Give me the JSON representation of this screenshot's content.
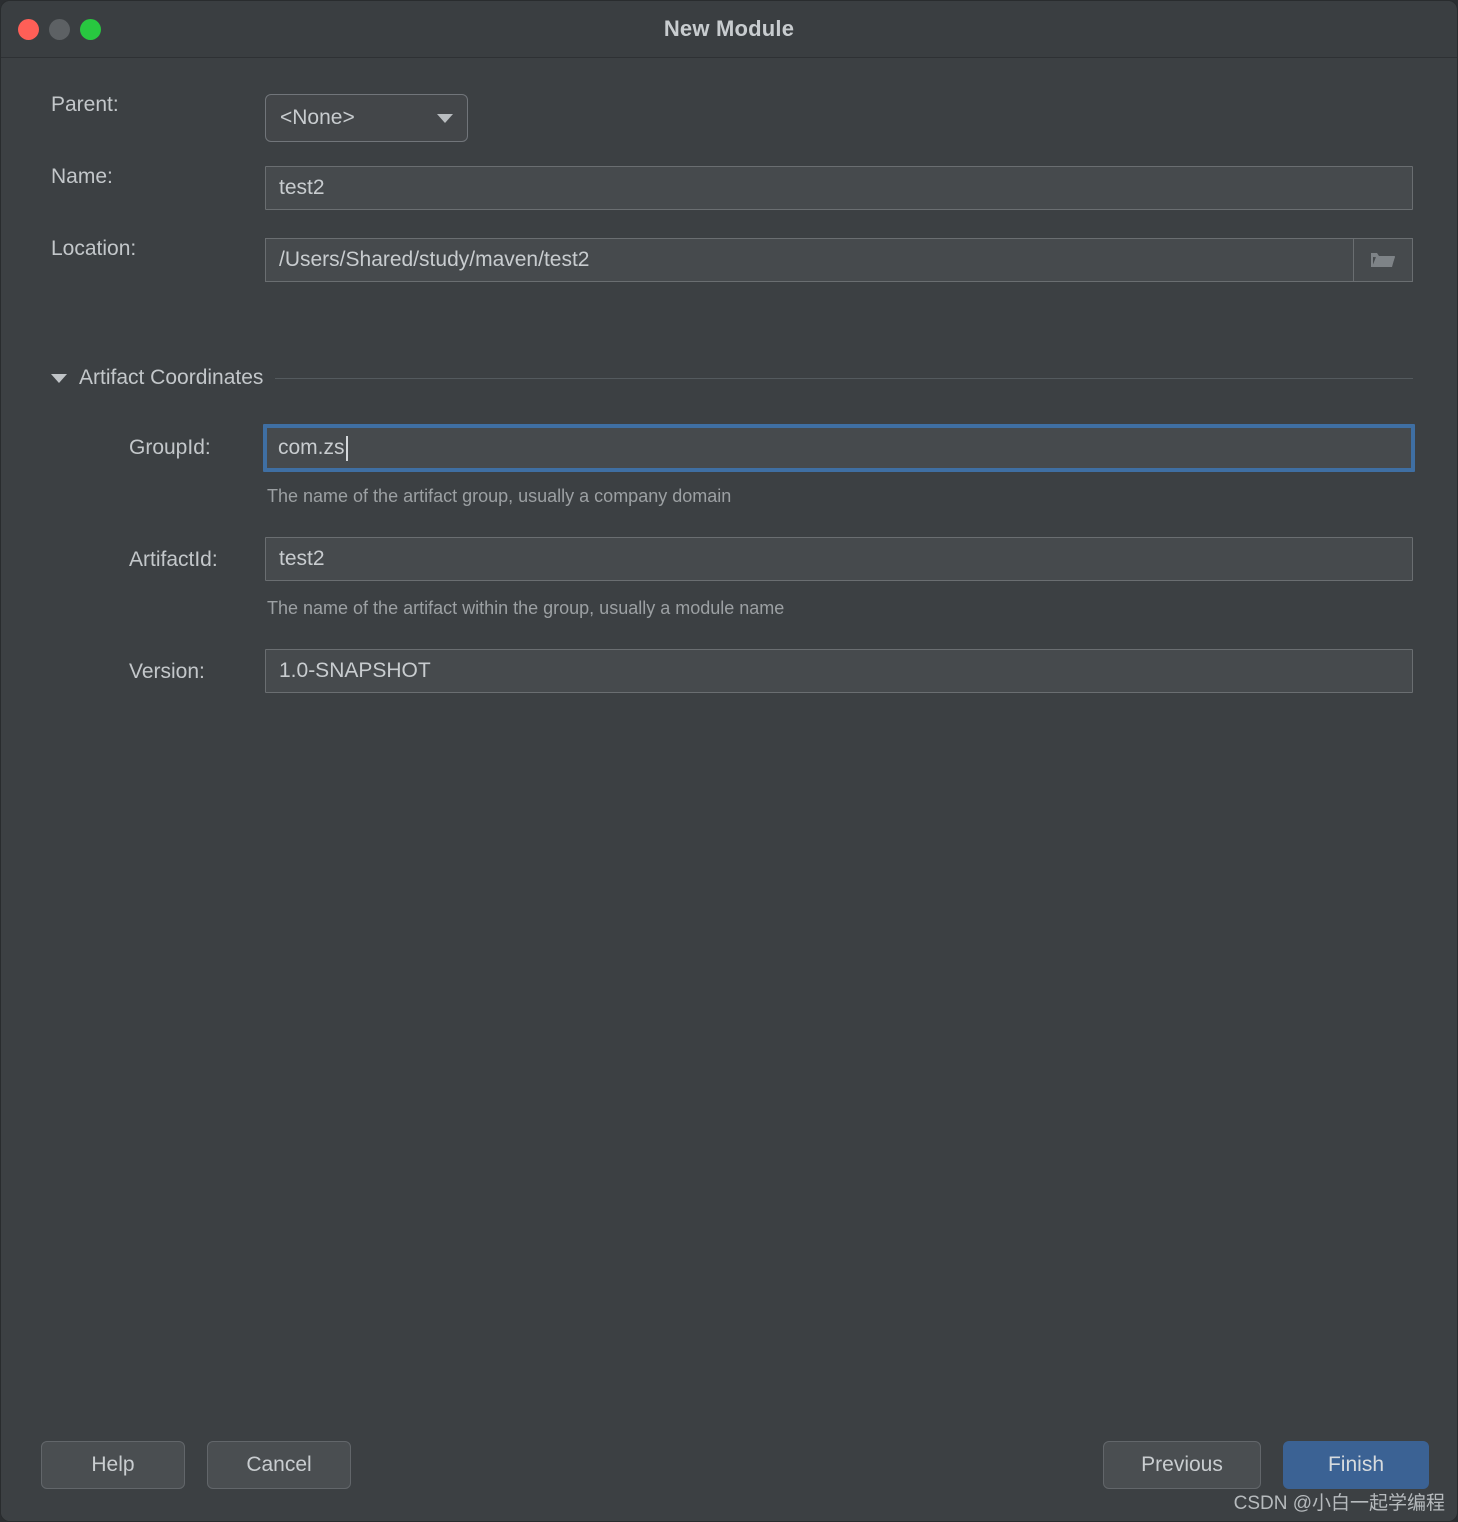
{
  "window": {
    "title": "New Module",
    "controls": {
      "close": "close-button",
      "minimize": "minimize-button",
      "maximize": "maximize-button"
    }
  },
  "form": {
    "parent": {
      "label": "Parent:",
      "value": "<None>",
      "options": [
        "<None>"
      ]
    },
    "name": {
      "label": "Name:",
      "value": "test2"
    },
    "location": {
      "label": "Location:",
      "value": "/Users/Shared/study/maven/test2",
      "browse_icon": "folder-icon"
    }
  },
  "artifact_section": {
    "title": "Artifact Coordinates",
    "expanded": true,
    "group_id": {
      "label": "GroupId:",
      "value": "com.zs",
      "hint": "The name of the artifact group, usually a company domain",
      "focused": true
    },
    "artifact_id": {
      "label": "ArtifactId:",
      "value": "test2",
      "hint": "The name of the artifact within the group, usually a module name"
    },
    "version": {
      "label": "Version:",
      "value": "1.0-SNAPSHOT"
    }
  },
  "footer": {
    "help_label": "Help",
    "cancel_label": "Cancel",
    "previous_label": "Previous",
    "finish_label": "Finish",
    "watermark": "CSDN @小白一起学编程"
  },
  "colors": {
    "window_bg": "#3c4043",
    "titlebar_bg": "#3a3e41",
    "field_bg": "#464a4d",
    "field_border": "#6a6e71",
    "accent_blue": "#3b6294",
    "focus_blue": "#3f6fa3",
    "text": "#c8cccf",
    "hint_text": "#9ca0a3",
    "traffic_close": "#ff5f57",
    "traffic_min": "#5d6164",
    "traffic_zoom": "#28c840"
  }
}
